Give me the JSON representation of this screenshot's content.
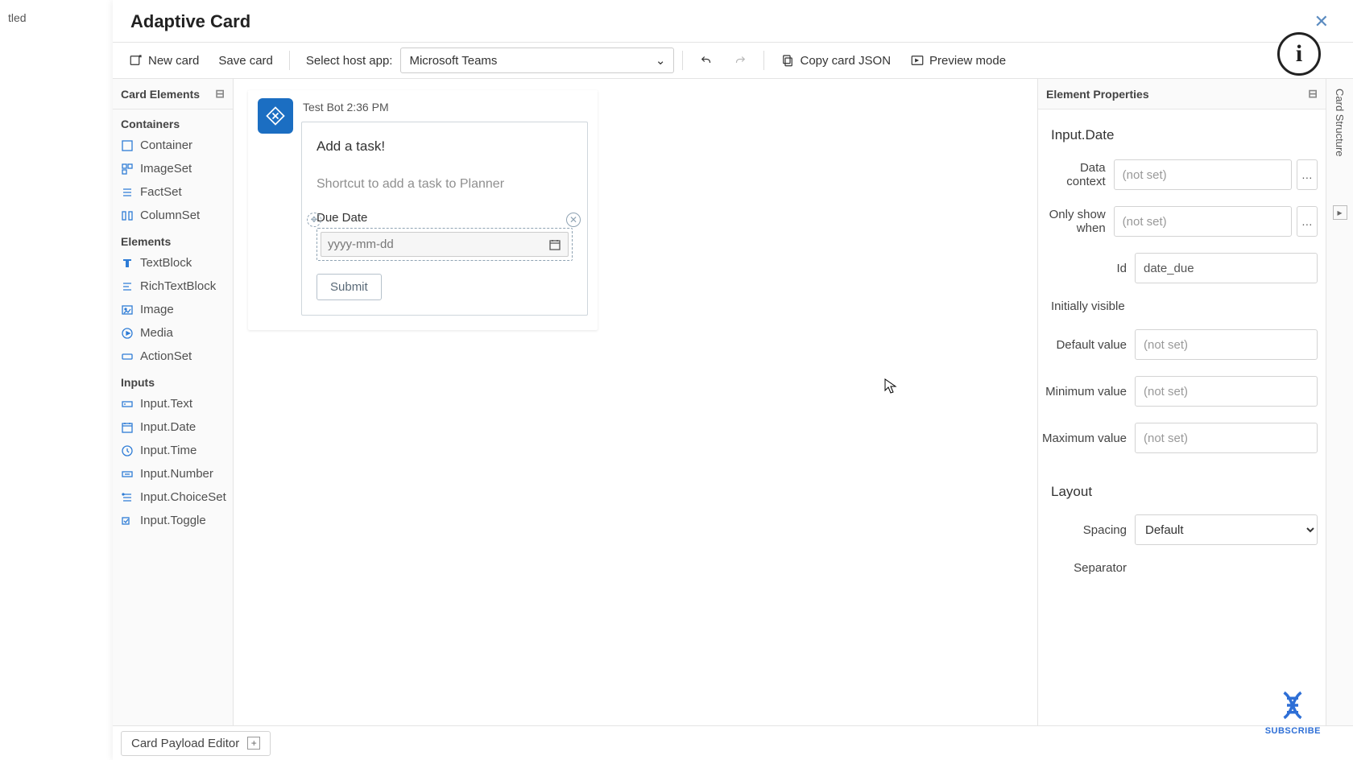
{
  "outer_tab": "tled",
  "window": {
    "title": "Adaptive Card"
  },
  "toolbar": {
    "new_card": "New card",
    "save_card": "Save card",
    "host_label": "Select host app:",
    "host_value": "Microsoft Teams",
    "copy_json": "Copy card JSON",
    "preview": "Preview mode"
  },
  "left": {
    "title": "Card Elements",
    "groups": {
      "containers": "Containers",
      "elements": "Elements",
      "inputs": "Inputs"
    },
    "items": {
      "container": "Container",
      "imageset": "ImageSet",
      "factset": "FactSet",
      "columnset": "ColumnSet",
      "textblock": "TextBlock",
      "richtextblock": "RichTextBlock",
      "image": "Image",
      "media": "Media",
      "actionset": "ActionSet",
      "input_text": "Input.Text",
      "input_date": "Input.Date",
      "input_time": "Input.Time",
      "input_number": "Input.Number",
      "input_choiceset": "Input.ChoiceSet",
      "input_toggle": "Input.Toggle"
    }
  },
  "canvas": {
    "bot_line": "Test Bot 2:36 PM",
    "card_title": "Add a task!",
    "card_subtitle": "Shortcut to add a task to Planner",
    "date_label": "Due Date",
    "date_placeholder": "yyyy-mm-dd",
    "submit": "Submit"
  },
  "right": {
    "title": "Element Properties",
    "section": "Input.Date",
    "labels": {
      "data_context": "Data context",
      "only_show_when": "Only show when",
      "id": "Id",
      "initially_visible": "Initially visible",
      "default_value": "Default value",
      "min_value": "Minimum value",
      "max_value": "Maximum value",
      "layout": "Layout",
      "spacing": "Spacing",
      "separator": "Separator"
    },
    "placeholder_not_set": "(not set)",
    "values": {
      "id": "date_due",
      "spacing": "Default"
    }
  },
  "rail": {
    "card_structure": "Card Structure"
  },
  "bottom": {
    "payload_editor": "Card Payload Editor"
  },
  "subscribe": "SUBSCRIBE"
}
